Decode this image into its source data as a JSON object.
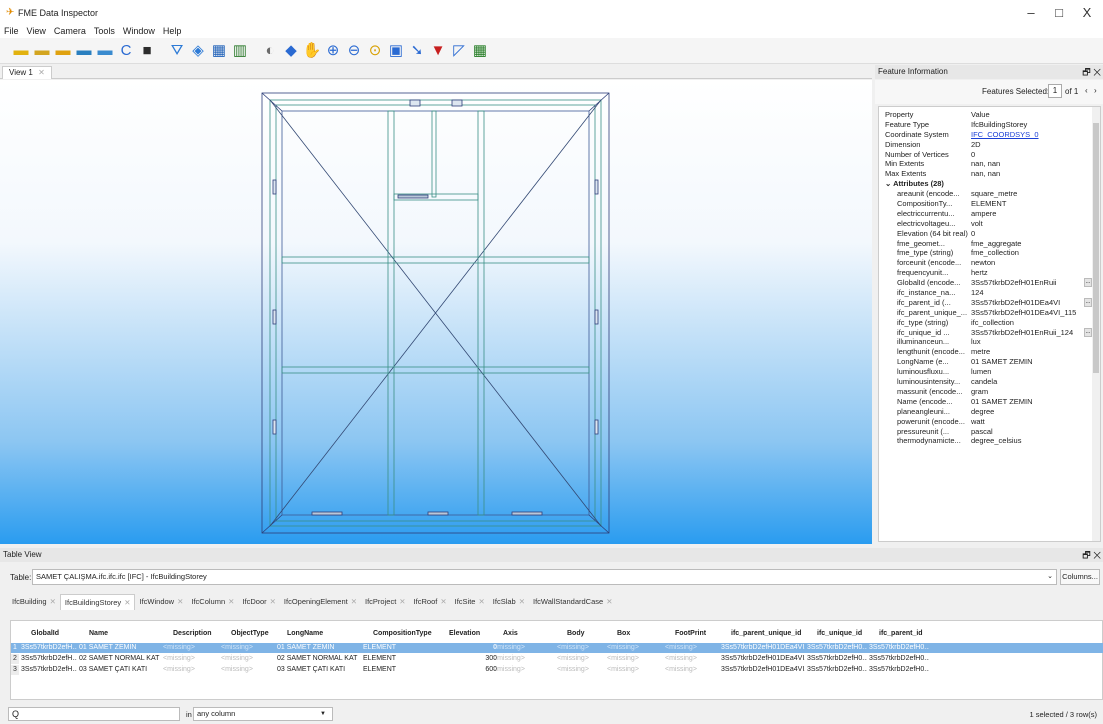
{
  "window": {
    "title": "FME Data Inspector",
    "controls": [
      "–",
      "□",
      "X"
    ]
  },
  "menu": [
    "File",
    "View",
    "Camera",
    "Tools",
    "Window",
    "Help"
  ],
  "toolbar": [
    {
      "icon": "new-folder-icon",
      "glyph": "▬"
    },
    {
      "icon": "open-dataset-icon",
      "glyph": "▬"
    },
    {
      "icon": "open-folder-icon",
      "glyph": "▬"
    },
    {
      "icon": "add-dataset-icon",
      "glyph": "▬"
    },
    {
      "icon": "copy-icon",
      "glyph": "▬"
    },
    {
      "icon": "refresh-icon",
      "glyph": "C"
    },
    {
      "icon": "stop-icon",
      "glyph": "■"
    },
    {
      "icon": "shapes-icon",
      "glyph": "⛛"
    },
    {
      "icon": "paint-icon",
      "glyph": "◈"
    },
    {
      "icon": "grid-icon",
      "glyph": "▦"
    },
    {
      "icon": "table-icon",
      "glyph": "▥"
    },
    {
      "icon": "orbit-icon",
      "glyph": "◐"
    },
    {
      "icon": "select-icon",
      "glyph": "◆"
    },
    {
      "icon": "pan-icon",
      "glyph": "✋"
    },
    {
      "icon": "zoom-in-icon",
      "glyph": "⊕"
    },
    {
      "icon": "zoom-out-icon",
      "glyph": "⊖"
    },
    {
      "icon": "zoom-extents-icon",
      "glyph": "⊙"
    },
    {
      "icon": "zoom-box-icon",
      "glyph": "▣"
    },
    {
      "icon": "select-arrow-icon",
      "glyph": "➘"
    },
    {
      "icon": "filter-icon",
      "glyph": "▼"
    },
    {
      "icon": "measure-icon",
      "glyph": "◸"
    },
    {
      "icon": "table-view-icon",
      "glyph": "▦"
    }
  ],
  "toolbar_colors": [
    "#e2b20f",
    "#d3a520",
    "#e0a210",
    "#2a7fbf",
    "#3a8bcf",
    "#2a6ad2",
    "#2c2c2c",
    "#2c7ad6",
    "#2c7ad6",
    "#1c5fb8",
    "#2b7a2b",
    "#6b6b6b",
    "#2a6ad2",
    "#555555",
    "#2a6ad2",
    "#2a6ad2",
    "#d8a000",
    "#2a6ad2",
    "#2a6ad2",
    "#c71f1f",
    "#2a6ad2",
    "#1f7a1f"
  ],
  "view": {
    "tab": "View 1",
    "close": "✕"
  },
  "feature_info": {
    "title": "Feature Information",
    "float_icon": "🗗 ✕",
    "features_selected_label": "Features Selected:",
    "current": "1",
    "of_total": "of 1",
    "header": {
      "property": "Property",
      "value": "Value"
    },
    "rows": [
      {
        "p": "Feature Type",
        "v": "IfcBuildingStorey"
      },
      {
        "p": "Coordinate System",
        "v": "IFC_COORDSYS_0",
        "link": true
      },
      {
        "p": "Dimension",
        "v": "2D"
      },
      {
        "p": "Number of Vertices",
        "v": "0"
      },
      {
        "p": "Min Extents",
        "v": "nan, nan"
      },
      {
        "p": "Max Extents",
        "v": "nan, nan"
      }
    ],
    "attributes_label": "Attributes (28)",
    "attributes": [
      {
        "p": "areaunit (encode...",
        "v": "square_metre"
      },
      {
        "p": "CompositionTy...",
        "v": "ELEMENT"
      },
      {
        "p": "electriccurrentu...",
        "v": "ampere"
      },
      {
        "p": "electricvoltageu...",
        "v": "volt"
      },
      {
        "p": "Elevation (64 bit real)",
        "v": "0"
      },
      {
        "p": "fme_geomet...",
        "v": "fme_aggregate"
      },
      {
        "p": "fme_type (string)",
        "v": "fme_collection"
      },
      {
        "p": "forceunit (encode...",
        "v": "newton"
      },
      {
        "p": "frequencyunit...",
        "v": "hertz"
      },
      {
        "p": "GlobalId (encode...",
        "v": "3Ss57tkrbD2efH01EnRuii",
        "dots": true
      },
      {
        "p": "ifc_instance_na...",
        "v": "124"
      },
      {
        "p": "ifc_parent_id (...",
        "v": "3Ss57tkrbD2efH01DEa4VI",
        "dots": true
      },
      {
        "p": "ifc_parent_unique_...",
        "v": "3Ss57tkrbD2efH01DEa4VI_115"
      },
      {
        "p": "ifc_type (string)",
        "v": "ifc_collection"
      },
      {
        "p": "ifc_unique_id ...",
        "v": "3Ss57tkrbD2efH01EnRuii_124",
        "dots": true
      },
      {
        "p": "illuminanceun...",
        "v": "lux"
      },
      {
        "p": "lengthunit (encode...",
        "v": "metre"
      },
      {
        "p": "LongName (e...",
        "v": "01 SAMET ZEMIN"
      },
      {
        "p": "luminousfluxu...",
        "v": "lumen"
      },
      {
        "p": "luminousintensity...",
        "v": "candela"
      },
      {
        "p": "massunit (encode...",
        "v": "gram"
      },
      {
        "p": "Name (encode...",
        "v": "01 SAMET ZEMIN"
      },
      {
        "p": "planeangleuni...",
        "v": "degree"
      },
      {
        "p": "powerunit (encode...",
        "v": "watt"
      },
      {
        "p": "pressureunit (...",
        "v": "pascal"
      },
      {
        "p": "thermodynamicte...",
        "v": "degree_celsius"
      }
    ]
  },
  "table_view": {
    "title": "Table View",
    "float_icon": "🗗 ✕",
    "table_label": "Table:",
    "table_value": "SAMET ÇALIŞMA.ifc.ifc.ifc [IFC] - IfcBuildingStorey",
    "columns_button": "Columns...",
    "tabs": [
      "IfcBuilding",
      "IfcBuildingStorey",
      "IfcWindow",
      "IfcColumn",
      "IfcDoor",
      "IfcOpeningElement",
      "IfcProject",
      "IfcRoof",
      "IfcSite",
      "IfcSlab",
      "IfcWallStandardCase"
    ],
    "active_tab": 1,
    "columns": [
      "GlobalId",
      "Name",
      "Description",
      "ObjectType",
      "LongName",
      "CompositionType",
      "Elevation",
      "Axis",
      "Body",
      "Box",
      "FootPrint",
      "ifc_parent_unique_id",
      "ifc_unique_id",
      "ifc_parent_id"
    ],
    "rows": [
      [
        "1",
        "3Ss57tkrbD2efH...",
        "01 SAMET ZEMIN",
        "<missing>",
        "<missing>",
        "01 SAMET ZEMIN",
        "ELEMENT",
        "0",
        "<missing>",
        "<missing>",
        "<missing>",
        "<missing>",
        "3Ss57tkrbD2efH01DEa4VI...",
        "3Ss57tkrbD2efH0...",
        "3Ss57tkrbD2efH0..."
      ],
      [
        "2",
        "3Ss57tkrbD2efH...",
        "02 SAMET NORMAL KAT",
        "<missing>",
        "<missing>",
        "02 SAMET NORMAL KAT",
        "ELEMENT",
        "300",
        "<missing>",
        "<missing>",
        "<missing>",
        "<missing>",
        "3Ss57tkrbD2efH01DEa4VI...",
        "3Ss57tkrbD2efH0...",
        "3Ss57tkrbD2efH0..."
      ],
      [
        "3",
        "3Ss57tkrbD2efH...",
        "03 SAMET ÇATI KATI",
        "<missing>",
        "<missing>",
        "03 SAMET ÇATI KATI",
        "ELEMENT",
        "600",
        "<missing>",
        "<missing>",
        "<missing>",
        "<missing>",
        "3Ss57tkrbD2efH01DEa4VI...",
        "3Ss57tkrbD2efH0...",
        "3Ss57tkrbD2efH0..."
      ]
    ],
    "selected_row": 0,
    "search_placeholder": "Q",
    "search_in": "in",
    "column_select": "any column",
    "selection_count": "1 selected / 3 row(s)"
  }
}
